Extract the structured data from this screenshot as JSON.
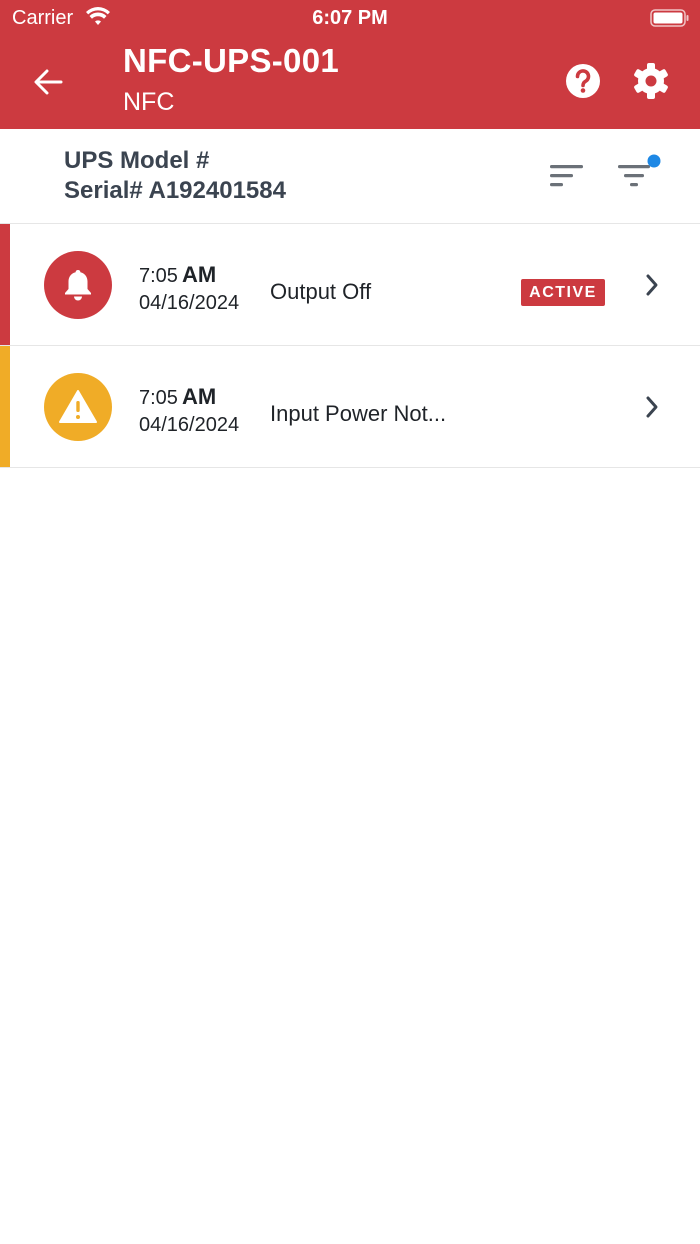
{
  "status_bar": {
    "carrier": "Carrier",
    "time": "6:07 PM"
  },
  "header": {
    "title": "NFC-UPS-001",
    "subtitle": "NFC"
  },
  "device": {
    "model": "UPS Model #",
    "serial": "Serial# A192401584"
  },
  "events": [
    {
      "time": "7:05",
      "ampm": "AM",
      "date": "04/16/2024",
      "title": "Output Off",
      "badge": "ACTIVE",
      "severity": "alarm",
      "color": "#cc3a40",
      "icon": "bell-icon"
    },
    {
      "time": "7:05",
      "ampm": "AM",
      "date": "04/16/2024",
      "title": "Input Power Not...",
      "badge": "",
      "severity": "warning",
      "color": "#f0ac27",
      "icon": "warning-icon"
    }
  ],
  "colors": {
    "brand": "#cc3a40",
    "warning": "#f0ac27",
    "filter_dot": "#1e88e5"
  }
}
